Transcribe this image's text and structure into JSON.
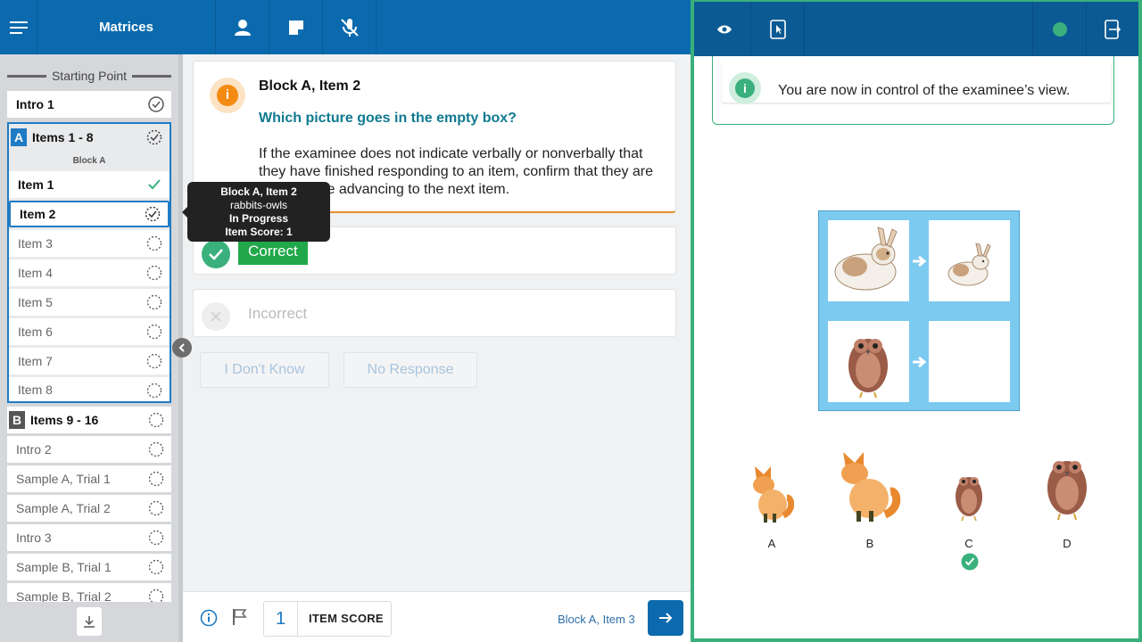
{
  "header": {
    "title": "Matrices",
    "icons": [
      "menu-icon",
      "person-icon",
      "note-icon",
      "mic-off-icon"
    ]
  },
  "sidebar": {
    "starting_point": "Starting Point",
    "intro1": "Intro 1",
    "blockA": {
      "badge": "A",
      "label": "Items 1 - 8",
      "sub": "Block A"
    },
    "items": [
      "Item 1",
      "Item 2",
      "Item 3",
      "Item 4",
      "Item 5",
      "Item 6",
      "Item 7",
      "Item 8"
    ],
    "blockB": {
      "badge": "B",
      "label": "Items 9 - 16"
    },
    "after": [
      "Intro 2",
      "Sample A, Trial 1",
      "Sample A, Trial 2",
      "Intro 3",
      "Sample B, Trial 1",
      "Sample B, Trial 2"
    ]
  },
  "card": {
    "heading": "Block A, Item 2",
    "question": "Which picture goes in the empty box?",
    "instruction": "If the examinee does not indicate verbally or nonverbally that they have finished responding to an item, confirm that they are done before advancing to the next item."
  },
  "tooltip": {
    "line1": "Block A, Item 2",
    "line2": "rabbits-owls",
    "line3": "In Progress",
    "line4": "Item Score: 1"
  },
  "responses": {
    "correct": "Correct",
    "incorrect": "Incorrect",
    "dont_know": "I Don't Know",
    "no_response": "No Response"
  },
  "footer": {
    "item_score_value": "1",
    "item_score_label": "ITEM SCORE",
    "next_label": "Block A, Item 3"
  },
  "examinee": {
    "notice": "You are now in control of the examinee’s view.",
    "options": [
      "A",
      "B",
      "C",
      "D"
    ],
    "selected_option": "C",
    "status_color": "#3ab07c"
  },
  "colors": {
    "header_blue": "#0b6aad",
    "accent_green": "#3ab07c",
    "correct_green": "#21a84a",
    "info_orange": "#f38a12",
    "question_teal": "#0f7a90"
  }
}
